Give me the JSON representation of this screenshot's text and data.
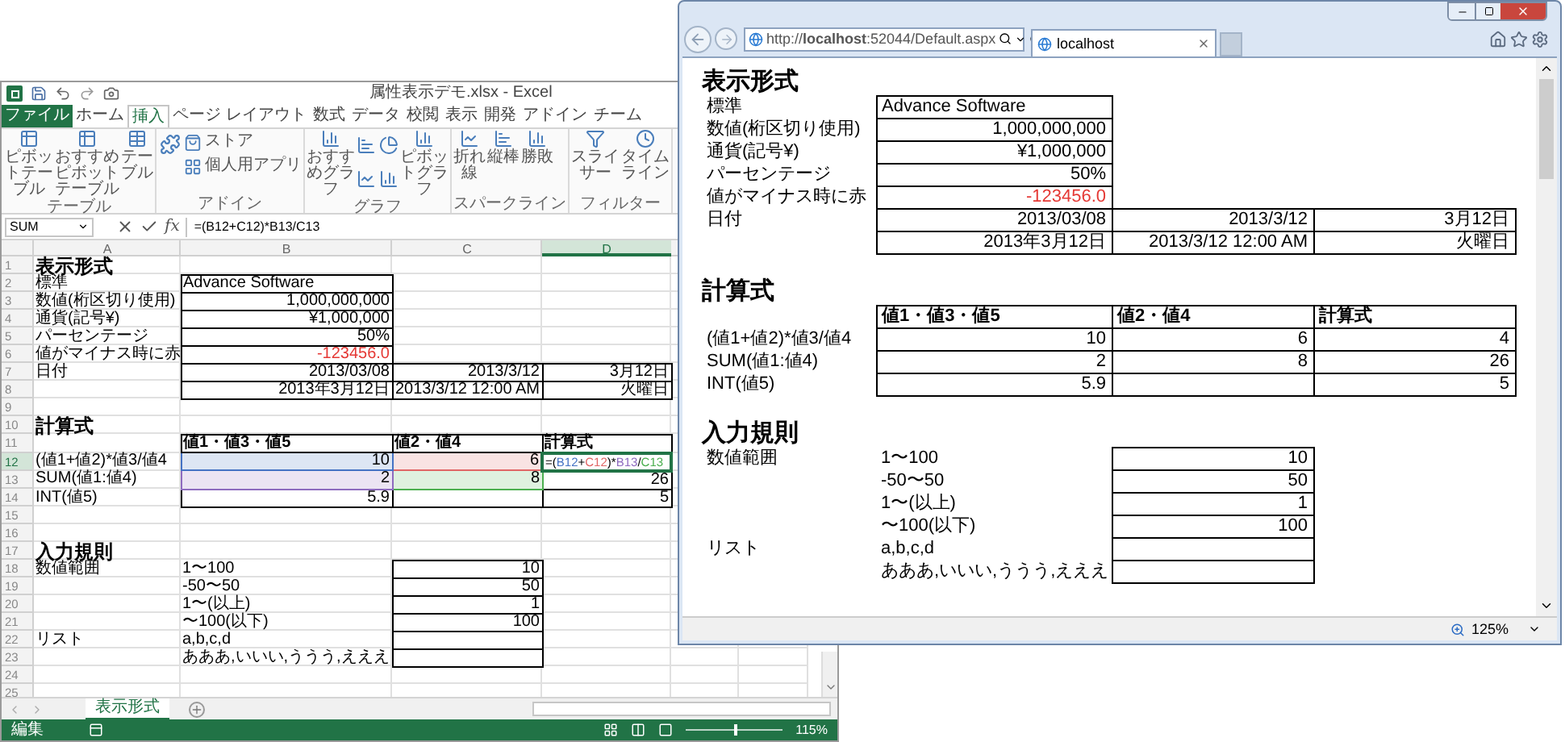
{
  "excel": {
    "title": "属性表示デモ.xlsx - Excel",
    "ribbon_tabs": [
      {
        "label": "ファイル",
        "kind": "file",
        "selected": false
      },
      {
        "label": "ホーム",
        "kind": "tab",
        "selected": false
      },
      {
        "label": "挿入",
        "kind": "tab",
        "selected": true
      },
      {
        "label": "ページ レイアウト",
        "kind": "tab",
        "selected": false
      },
      {
        "label": "数式",
        "kind": "tab",
        "selected": false
      },
      {
        "label": "データ",
        "kind": "tab",
        "selected": false
      },
      {
        "label": "校閲",
        "kind": "tab",
        "selected": false
      },
      {
        "label": "表示",
        "kind": "tab",
        "selected": false
      },
      {
        "label": "開発",
        "kind": "tab",
        "selected": false
      },
      {
        "label": "アドイン",
        "kind": "tab",
        "selected": false
      },
      {
        "label": "チーム",
        "kind": "tab",
        "selected": false
      }
    ],
    "ribbon_groups": [
      {
        "label": "テーブル",
        "buttons": [
          {
            "label": "ピボットテーブル",
            "kind": "pivot"
          },
          {
            "label": "おすすめピボットテーブル",
            "kind": "pivot_recommend"
          },
          {
            "label": "テーブル",
            "kind": "table"
          }
        ]
      },
      {
        "label": "アドイン",
        "buttons": [
          {
            "kind": "addin"
          },
          {
            "label": "ストア",
            "kind": "store"
          },
          {
            "label": "個人用アプリ",
            "kind": "apps"
          }
        ]
      },
      {
        "label": "グラフ",
        "buttons": [
          {
            "label": "おすすめグラフ",
            "kind": "chart_recommend"
          },
          {
            "kind": "chart_types"
          },
          {
            "label": "ピボットグラフ",
            "kind": "pivot_chart"
          }
        ]
      },
      {
        "label": "スパークライン",
        "buttons": [
          {
            "label": "折れ線",
            "kind": "line"
          },
          {
            "label": "縦棒",
            "kind": "column"
          },
          {
            "label": "勝敗",
            "kind": "winloss"
          }
        ]
      },
      {
        "label": "フィルター",
        "buttons": [
          {
            "label": "スライサー",
            "kind": "slicer"
          },
          {
            "label": "タイムライン",
            "kind": "timeline"
          }
        ]
      }
    ],
    "name_box": "SUM",
    "fx_label": "fx",
    "formula": "=(B12+C12)*B13/C13",
    "columns": [
      {
        "label": "A",
        "selected": false
      },
      {
        "label": "B",
        "selected": false
      },
      {
        "label": "C",
        "selected": false
      },
      {
        "label": "D",
        "selected": true
      }
    ],
    "rows": [
      {
        "number": "1",
        "selected": false,
        "cells": [
          {
            "kind": "heading",
            "text": "表示形式"
          }
        ]
      },
      {
        "number": "2",
        "selected": false,
        "cells": [
          {
            "kind": "label",
            "text": "標準"
          },
          {
            "kind": "text",
            "text": "Advance Software"
          }
        ]
      },
      {
        "number": "3",
        "selected": false,
        "cells": [
          {
            "kind": "label",
            "text": "数値(桁区切り使用)"
          },
          {
            "kind": "number",
            "text": "1,000,000,000"
          }
        ]
      },
      {
        "number": "4",
        "selected": false,
        "cells": [
          {
            "kind": "label",
            "text": "通貨(記号¥)"
          },
          {
            "kind": "number",
            "text": "¥1,000,000"
          }
        ]
      },
      {
        "number": "5",
        "selected": false,
        "cells": [
          {
            "kind": "label",
            "text": "パーセンテージ"
          },
          {
            "kind": "number",
            "text": "50%"
          }
        ]
      },
      {
        "number": "6",
        "selected": false,
        "cells": [
          {
            "kind": "label",
            "text": "値がマイナス時に赤"
          },
          {
            "kind": "negative",
            "text": "-123456.0"
          }
        ]
      },
      {
        "number": "7",
        "selected": false,
        "cells": [
          {
            "kind": "label",
            "text": "日付"
          },
          {
            "kind": "number",
            "text": "2013/03/08"
          },
          {
            "kind": "number",
            "text": "2013/3/12"
          },
          {
            "kind": "number",
            "text": "3月12日"
          }
        ]
      },
      {
        "number": "8",
        "selected": false,
        "cells": [
          null,
          {
            "kind": "number",
            "text": "2013年3月12日"
          },
          {
            "kind": "number",
            "text": "2013/3/12 12:00 AM"
          },
          {
            "kind": "number",
            "text": "火曜日"
          }
        ]
      },
      {
        "number": "9",
        "selected": false
      },
      {
        "number": "10",
        "selected": false,
        "cells": [
          {
            "kind": "heading",
            "text": "計算式"
          }
        ]
      },
      {
        "number": "11",
        "selected": false,
        "cells": [
          null,
          {
            "kind": "header",
            "text": "値1・値3・値5"
          },
          {
            "kind": "header",
            "text": "値2・値4"
          },
          {
            "kind": "header",
            "text": "計算式"
          }
        ]
      },
      {
        "number": "12",
        "selected": true,
        "cells": [
          {
            "kind": "label",
            "text": "(値1+値2)*値3/値4"
          },
          {
            "kind": "number",
            "text": "10",
            "color": "#4472c4"
          },
          {
            "kind": "number",
            "text": "6",
            "color": "#e06666"
          },
          {
            "kind": "formula",
            "segments": [
              {
                "text": "=("
              },
              {
                "text": "B12",
                "color": "#4472c4"
              },
              {
                "text": "+"
              },
              {
                "text": "C12",
                "color": "#e06666"
              },
              {
                "text": ")*"
              },
              {
                "text": "B13",
                "color": "#8e6bbf"
              },
              {
                "text": "/"
              },
              {
                "text": "C13",
                "color": "#4caf50"
              }
            ]
          }
        ]
      },
      {
        "number": "13",
        "selected": false,
        "cells": [
          {
            "kind": "label",
            "text": "SUM(値1:値4)"
          },
          {
            "kind": "number",
            "text": "2",
            "color": "#8e6bbf"
          },
          {
            "kind": "number",
            "text": "8",
            "color": "#4caf50"
          },
          {
            "kind": "number",
            "text": "26"
          }
        ]
      },
      {
        "number": "14",
        "selected": false,
        "cells": [
          {
            "kind": "label",
            "text": "INT(値5)"
          },
          {
            "kind": "number",
            "text": "5.9"
          },
          {
            "kind": "box"
          },
          {
            "kind": "number",
            "text": "5"
          }
        ]
      },
      {
        "number": "15",
        "selected": false
      },
      {
        "number": "16",
        "selected": false
      },
      {
        "number": "17",
        "selected": false,
        "cells": [
          {
            "kind": "heading",
            "text": "入力規則"
          }
        ]
      },
      {
        "number": "18",
        "selected": false,
        "cells": [
          {
            "kind": "label",
            "text": "数値範囲"
          },
          {
            "kind": "label",
            "text": "1〜100"
          },
          {
            "kind": "number",
            "text": "10"
          }
        ]
      },
      {
        "number": "19",
        "selected": false,
        "cells": [
          null,
          {
            "kind": "label",
            "text": "-50〜50"
          },
          {
            "kind": "number",
            "text": "50"
          }
        ]
      },
      {
        "number": "20",
        "selected": false,
        "cells": [
          null,
          {
            "kind": "label",
            "text": "1〜(以上)"
          },
          {
            "kind": "number",
            "text": "1"
          }
        ]
      },
      {
        "number": "21",
        "selected": false,
        "cells": [
          null,
          {
            "kind": "label",
            "text": "〜100(以下)"
          },
          {
            "kind": "number",
            "text": "100"
          }
        ]
      },
      {
        "number": "22",
        "selected": false,
        "cells": [
          {
            "kind": "label",
            "text": "リスト"
          },
          {
            "kind": "label",
            "text": "a,b,c,d"
          },
          {
            "kind": "box"
          }
        ]
      },
      {
        "number": "23",
        "selected": false,
        "cells": [
          null,
          {
            "kind": "label",
            "text": "あああ,いいい,ううう,えええ"
          },
          {
            "kind": "box"
          }
        ]
      },
      {
        "number": "24",
        "selected": false
      },
      {
        "number": "25",
        "selected": false
      }
    ],
    "sheet_tabs": [
      {
        "label": "表示形式",
        "selected": true
      }
    ],
    "status_bar": {
      "mode": "編集",
      "zoom": "115%",
      "zoom_slider": {
        "level": 0.5
      }
    }
  },
  "browser": {
    "address": "http://**localhost**:52044/Default.aspx",
    "tab": "localhost",
    "sections": [
      {
        "heading": "表示形式",
        "rows": [
          {
            "cells": [
              {
                "kind": "label",
                "text": "標準"
              },
              {
                "kind": "text",
                "text": "Advance Software"
              }
            ]
          },
          {
            "cells": [
              {
                "kind": "label",
                "text": "数値(桁区切り使用)"
              },
              {
                "kind": "number",
                "text": "1,000,000,000"
              }
            ]
          },
          {
            "cells": [
              {
                "kind": "label",
                "text": "通貨(記号¥)"
              },
              {
                "kind": "number",
                "text": "¥1,000,000"
              }
            ]
          },
          {
            "cells": [
              {
                "kind": "label",
                "text": "パーセンテージ"
              },
              {
                "kind": "number",
                "text": "50%"
              }
            ]
          },
          {
            "cells": [
              {
                "kind": "label",
                "text": "値がマイナス時に赤"
              },
              {
                "kind": "negative",
                "text": "-123456.0"
              }
            ]
          },
          {
            "cells": [
              {
                "kind": "label",
                "text": "日付"
              },
              {
                "kind": "number",
                "text": "2013/03/08"
              },
              {
                "kind": "number",
                "text": "2013/3/12"
              },
              {
                "kind": "number",
                "text": "3月12日"
              }
            ]
          },
          {
            "cells": [
              null,
              {
                "kind": "number",
                "text": "2013年3月12日"
              },
              {
                "kind": "number",
                "text": "2013/3/12 12:00 AM"
              },
              {
                "kind": "number",
                "text": "火曜日"
              }
            ]
          }
        ]
      },
      {
        "heading": "計算式",
        "rows": [
          {
            "cells": [
              null,
              {
                "kind": "header",
                "text": "値1・値3・値5"
              },
              {
                "kind": "header",
                "text": "値2・値4"
              },
              {
                "kind": "header",
                "text": "計算式"
              }
            ]
          },
          {
            "cells": [
              {
                "kind": "label",
                "text": "(値1+値2)*値3/値4"
              },
              {
                "kind": "number",
                "text": "10"
              },
              {
                "kind": "number",
                "text": "6"
              },
              {
                "kind": "number",
                "text": "4"
              }
            ]
          },
          {
            "cells": [
              {
                "kind": "label",
                "text": "SUM(値1:値4)"
              },
              {
                "kind": "number",
                "text": "2"
              },
              {
                "kind": "number",
                "text": "8"
              },
              {
                "kind": "number",
                "text": "26"
              }
            ]
          },
          {
            "cells": [
              {
                "kind": "label",
                "text": "INT(値5)"
              },
              {
                "kind": "number",
                "text": "5.9"
              },
              {
                "kind": "box"
              },
              {
                "kind": "number",
                "text": "5"
              }
            ]
          }
        ]
      },
      {
        "heading": "入力規則",
        "rows": [
          {
            "cells": [
              {
                "kind": "label",
                "text": "数値範囲"
              },
              {
                "kind": "label",
                "text": "1〜100"
              },
              {
                "kind": "number",
                "text": "10"
              }
            ]
          },
          {
            "cells": [
              null,
              {
                "kind": "label",
                "text": "-50〜50"
              },
              {
                "kind": "number",
                "text": "50"
              }
            ]
          },
          {
            "cells": [
              null,
              {
                "kind": "label",
                "text": "1〜(以上)"
              },
              {
                "kind": "number",
                "text": "1"
              }
            ]
          },
          {
            "cells": [
              null,
              {
                "kind": "label",
                "text": "〜100(以下)"
              },
              {
                "kind": "number",
                "text": "100"
              }
            ]
          },
          {
            "cells": [
              {
                "kind": "label",
                "text": "リスト"
              },
              {
                "kind": "label",
                "text": "a,b,c,d"
              },
              {
                "kind": "box"
              }
            ]
          },
          {
            "cells": [
              null,
              {
                "kind": "label",
                "text": "あああ,いいい,ううう,えええ"
              },
              {
                "kind": "box"
              }
            ]
          }
        ]
      }
    ],
    "zoom": "125%"
  }
}
